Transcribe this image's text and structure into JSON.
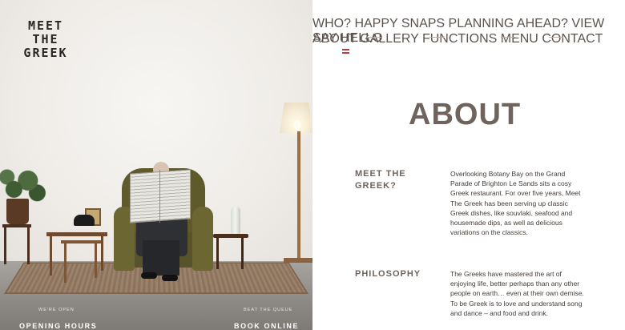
{
  "brand": {
    "logo_lines": [
      "MEET",
      "THE",
      "GREEK"
    ]
  },
  "photo_footer": {
    "left_small": "WE'RE OPEN",
    "left_big": "OPENING HOURS",
    "right_small": "BEAT THE QUEUE",
    "right_big": "BOOK ONLINE"
  },
  "subnav": [
    "WHO?",
    "HAPPY SNAPS",
    "PLANNING AHEAD?",
    "VIEW",
    "SAY HELLO"
  ],
  "mainnav": [
    "ABOUT",
    "GALLERY",
    "FUNCTIONS",
    "MENU",
    "CONTACT"
  ],
  "page": {
    "title": "ABOUT",
    "sections": [
      {
        "heading": "MEET THE GREEK?",
        "body": "Overlooking Botany Bay on the Grand Parade of Brighton Le Sands sits a cosy Greek restaurant. For over five years, Meet The Greek has been serving up classic Greek dishes, like souvlaki, seafood and housemade dips, as well as delicious variations on the classics."
      },
      {
        "heading": "PHILOSOPHY",
        "body": "The Greeks have mastered the art of enjoying life, better perhaps than any other people on earth… even at their own demise. To be Greek is to love and understand song and dance – and food and drink."
      }
    ]
  },
  "colors": {
    "accent_red": "#c0393b",
    "heading": "#6e635d",
    "nav_text": "#3e3733"
  },
  "icons": {
    "menu": "hamburger-icon"
  }
}
